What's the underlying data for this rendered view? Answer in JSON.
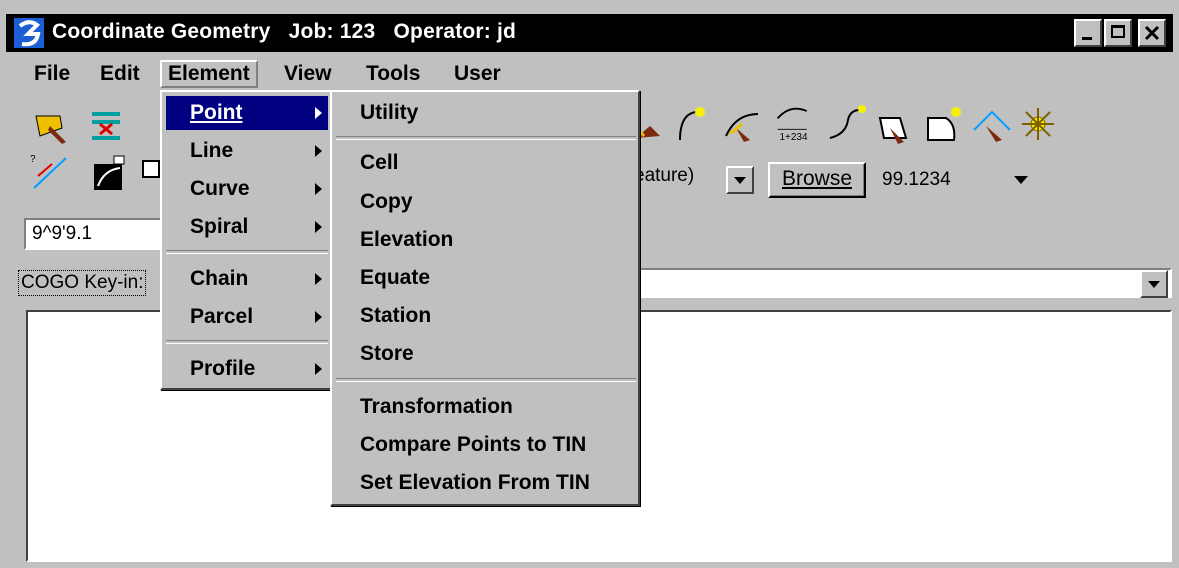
{
  "window": {
    "title": "Coordinate Geometry   Job: 123   Operator: jd"
  },
  "menubar": {
    "items": [
      {
        "label": "File",
        "mnemonic": "F"
      },
      {
        "label": "Edit",
        "mnemonic": "E"
      },
      {
        "label": "Element",
        "mnemonic": "m"
      },
      {
        "label": "View",
        "mnemonic": "V"
      },
      {
        "label": "Tools",
        "mnemonic": "T"
      },
      {
        "label": "User",
        "mnemonic": "U"
      }
    ]
  },
  "toolbar": {
    "point_field_value": "9^9'9.1",
    "feature_field_value": "eature)",
    "browse_label": "Browse",
    "precision_value": "99.1234"
  },
  "keyin": {
    "label": "COGO Key-in:"
  },
  "element_menu": {
    "items": [
      "Point",
      "Line",
      "Curve",
      "Spiral",
      "Chain",
      "Parcel",
      "Profile"
    ]
  },
  "point_submenu": {
    "items": [
      "Utility",
      "Cell",
      "Copy",
      "Elevation",
      "Equate",
      "Station",
      "Store",
      "Transformation",
      "Compare Points to TIN",
      "Set Elevation From TIN"
    ]
  },
  "icons": [
    "app-logo-icon",
    "select-icon",
    "list-icon",
    "arc-tool-icon",
    "station-1234-icon",
    "shape-tool-icon",
    "sun-icon"
  ],
  "colors": {
    "titlebar": "#000000",
    "highlight": "#000080",
    "face": "#c0c0c0"
  }
}
